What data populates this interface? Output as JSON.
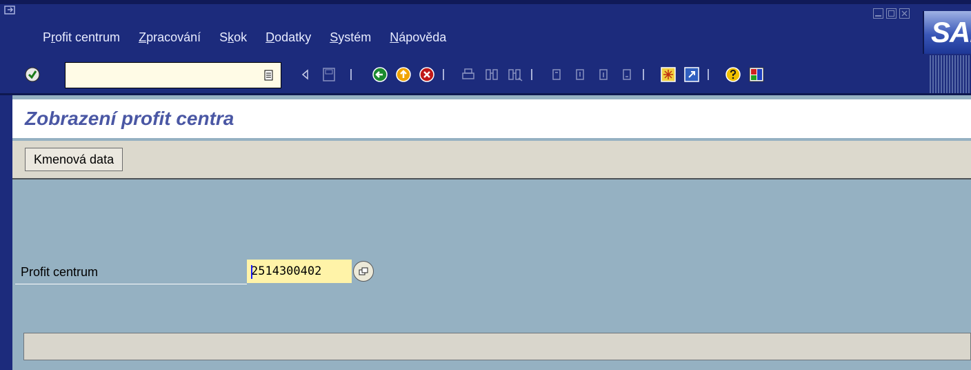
{
  "window": {
    "menu": [
      {
        "pre": "P",
        "ul": "r",
        "post": "ofit centrum"
      },
      {
        "pre": "",
        "ul": "Z",
        "post": "pracování"
      },
      {
        "pre": "S",
        "ul": "k",
        "post": "ok"
      },
      {
        "pre": "",
        "ul": "D",
        "post": "odatky"
      },
      {
        "pre": "",
        "ul": "S",
        "post": "ystém"
      },
      {
        "pre": "",
        "ul": "N",
        "post": "ápověda"
      }
    ],
    "logo_text": "SAP"
  },
  "toolbar": {
    "command_field_value": "",
    "icons": [
      "enter-check-icon",
      "command-field-dropdown-icon",
      "back-triangle-icon",
      "save-icon",
      "back-icon",
      "exit-icon",
      "cancel-icon",
      "print-icon",
      "find-icon",
      "find-next-icon",
      "first-page-icon",
      "previous-page-icon",
      "next-page-icon",
      "last-page-icon",
      "create-session-icon",
      "shortcut-icon",
      "help-icon",
      "layout-menu-icon"
    ]
  },
  "header": {
    "title": "Zobrazení profit centra"
  },
  "app_toolbar": {
    "master_data_button": "Kmenová data"
  },
  "form": {
    "profit_center_label": "Profit centrum",
    "profit_center_value": "2514300402"
  },
  "status_bar": {
    "message": ""
  },
  "colors": {
    "frame": "#1c2b7c",
    "background": "#95b1c2",
    "title_text": "#4a57a4",
    "input_highlight": "#fff3a8"
  }
}
